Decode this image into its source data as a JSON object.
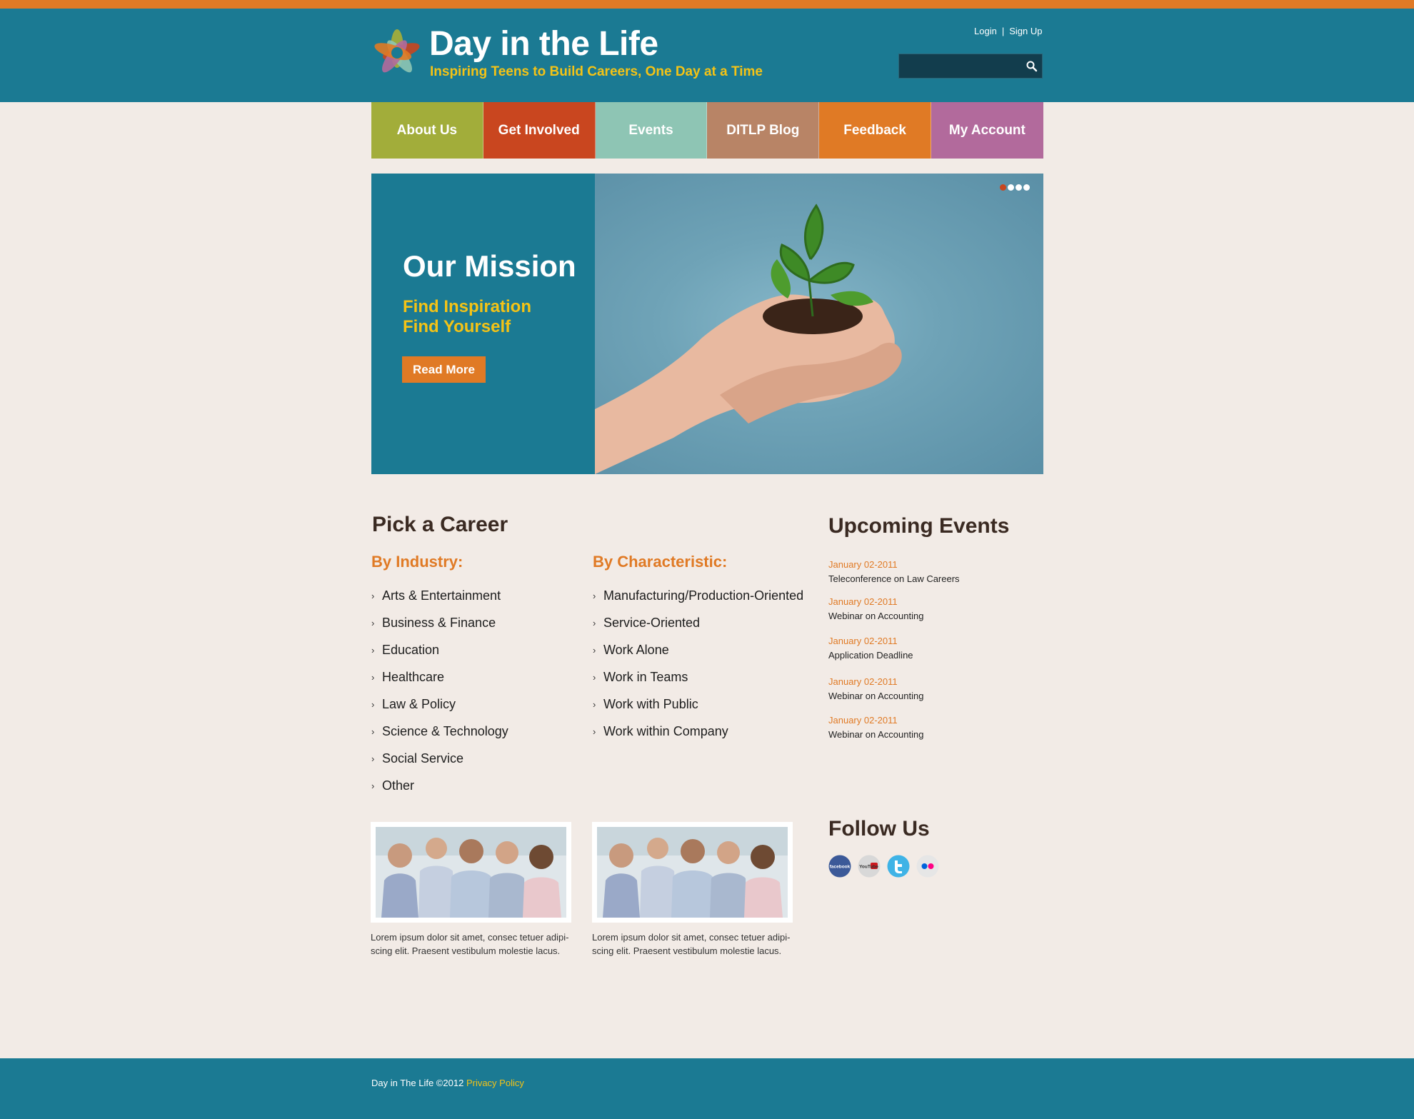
{
  "header": {
    "title": "Day in the Life",
    "tagline": "Inspiring Teens to Build Careers, One Day at a Time",
    "login": "Login",
    "separator": "|",
    "signup": "Sign Up",
    "search_placeholder": ""
  },
  "nav": {
    "items": [
      {
        "label": "About Us",
        "color": "#a2ad3a"
      },
      {
        "label": "Get Involved",
        "color": "#c9461f"
      },
      {
        "label": "Events",
        "color": "#8ec5b4"
      },
      {
        "label": "DITLP Blog",
        "color": "#b88466"
      },
      {
        "label": "Feedback",
        "color": "#e07a25"
      },
      {
        "label": "My Account",
        "color": "#b26a9c"
      }
    ]
  },
  "slider": {
    "title": "Our Mission",
    "line1": "Find Inspiration",
    "line2": "Find Yourself",
    "button": "Read More",
    "active_slide": 1,
    "slide_count": 4
  },
  "careers": {
    "title": "Pick a Career",
    "industry_heading": "By Industry:",
    "industry": [
      "Arts & Entertainment",
      "Business & Finance",
      "Education",
      "Healthcare",
      "Law & Policy",
      "Science & Technology",
      "Social Service",
      "Other"
    ],
    "characteristic_heading": "By Characteristic:",
    "characteristic": [
      "Manufacturing/Production-Oriented",
      "Service-Oriented",
      "Work Alone",
      "Work in Teams",
      "Work with Public",
      "Work within Company"
    ]
  },
  "events": {
    "title": "Upcoming Events",
    "items": [
      {
        "date": "January 02-2011",
        "name": "Teleconference on Law Careers"
      },
      {
        "date": "January 02-2011",
        "name": "Webinar on Accounting"
      },
      {
        "date": "January 02-2011",
        "name": "Application Deadline"
      },
      {
        "date": "January 02-2011",
        "name": "Webinar on Accounting"
      },
      {
        "date": "January 02-2011",
        "name": "Webinar on Accounting"
      }
    ]
  },
  "promos": [
    {
      "line1": "Lorem ipsum dolor sit amet, consec tetuer adipi-",
      "line2": "scing elit. Praesent vestibulum molestie lacus."
    },
    {
      "line1": "Lorem ipsum dolor sit amet, consec tetuer adipi-",
      "line2": "scing elit. Praesent vestibulum molestie lacus."
    }
  ],
  "follow": {
    "title": "Follow Us",
    "icons": [
      "facebook-icon",
      "youtube-icon",
      "twitter-icon",
      "flickr-icon"
    ],
    "facebook_text": "facebook",
    "youtube_text": "YouTube"
  },
  "footer": {
    "copyright": "Day in The Life ©2012",
    "privacy": "Privacy Policy"
  }
}
